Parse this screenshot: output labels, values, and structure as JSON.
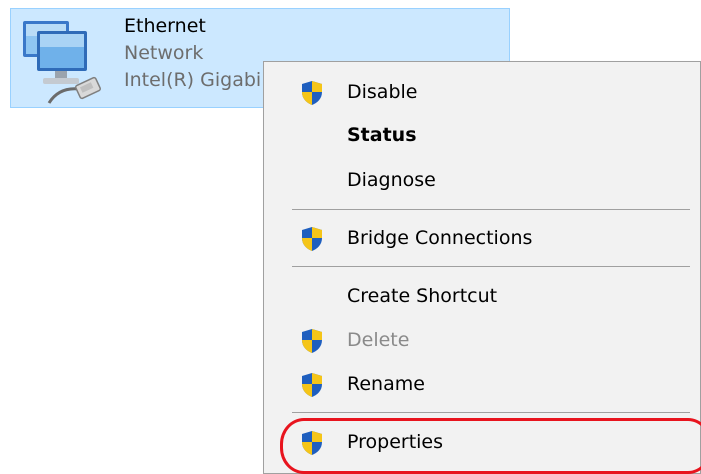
{
  "adapter": {
    "name": "Ethernet",
    "status": "Network",
    "device": "Intel(R) Gigabi",
    "icon": "network-adapter-icon"
  },
  "menu": {
    "items": [
      {
        "label": "Disable",
        "icon": "uac-shield-icon",
        "style": "normal"
      },
      {
        "label": "Status",
        "icon": "",
        "style": "bold"
      },
      {
        "label": "Diagnose",
        "icon": "",
        "style": "normal"
      },
      {
        "label": "Bridge Connections",
        "icon": "uac-shield-icon",
        "style": "normal"
      },
      {
        "label": "Create Shortcut",
        "icon": "",
        "style": "normal"
      },
      {
        "label": "Delete",
        "icon": "uac-shield-icon",
        "style": "disabled"
      },
      {
        "label": "Rename",
        "icon": "uac-shield-icon",
        "style": "normal"
      },
      {
        "label": "Properties",
        "icon": "uac-shield-icon",
        "style": "normal"
      }
    ],
    "highlighted_item": "Properties",
    "highlight_color": "#e8141e"
  },
  "colors": {
    "selection_bg": "#cce8ff",
    "selection_border": "#99d1ff",
    "menu_bg": "#f2f2f2",
    "shield_blue": "#1f5fbf",
    "shield_yellow": "#f5c518"
  }
}
